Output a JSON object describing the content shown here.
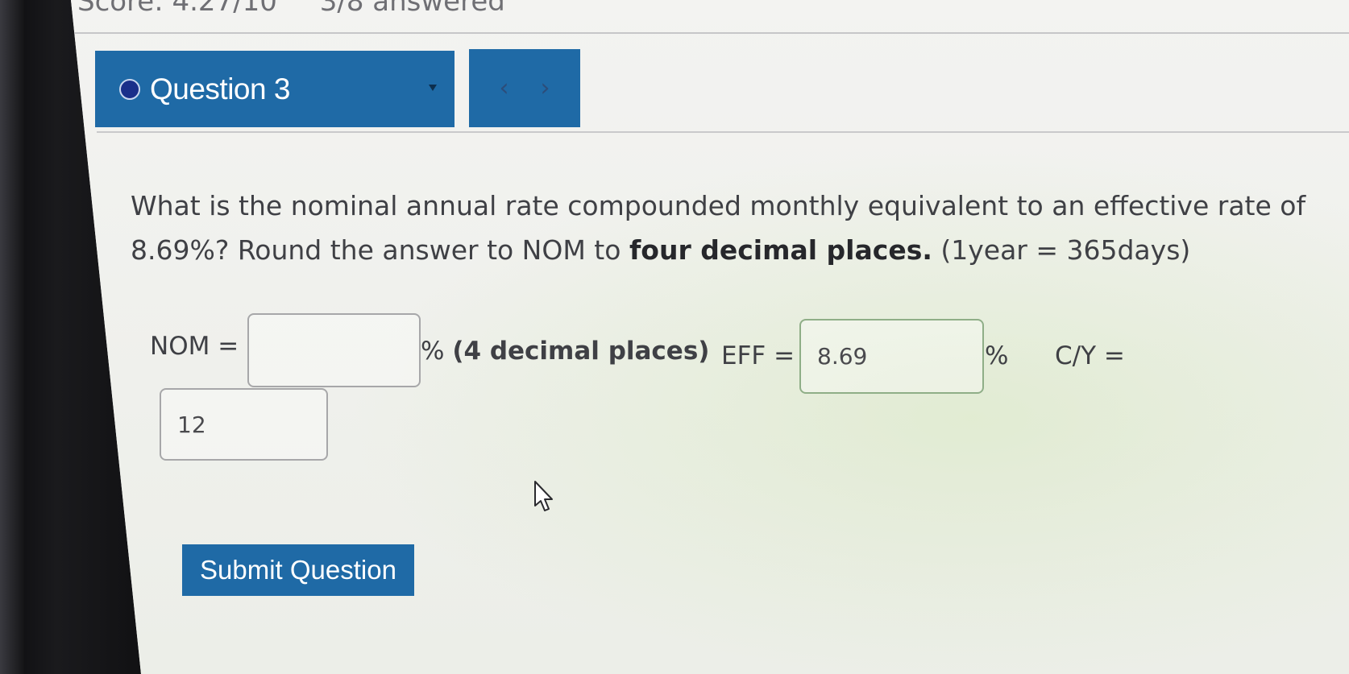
{
  "header": {
    "score": "Score: 4.27/10",
    "answered": "3/8 answered"
  },
  "question_nav": {
    "label": "Question 3",
    "prev_icon": "‹",
    "next_icon": "›"
  },
  "question": {
    "text_part1": "What is the nominal annual rate compounded monthly equivalent to an effective rate of 8.69%? Round the answer to NOM to ",
    "text_bold": "four decimal places.",
    "text_part2": " (1year = 365days)"
  },
  "answer_row": {
    "nom_label": "NOM =",
    "nom_value": "",
    "nom_suffix_percent": "% ",
    "nom_suffix_bold": "(4 decimal places)",
    "eff_label": "EFF =",
    "eff_value": "8.69",
    "eff_suffix": "%",
    "cy_label": "C/Y =",
    "cy_value": "12"
  },
  "submit": {
    "label": "Submit Question"
  },
  "colors": {
    "accent": "#1f6aa6",
    "text": "#3f4045",
    "bezel": "#121214"
  }
}
